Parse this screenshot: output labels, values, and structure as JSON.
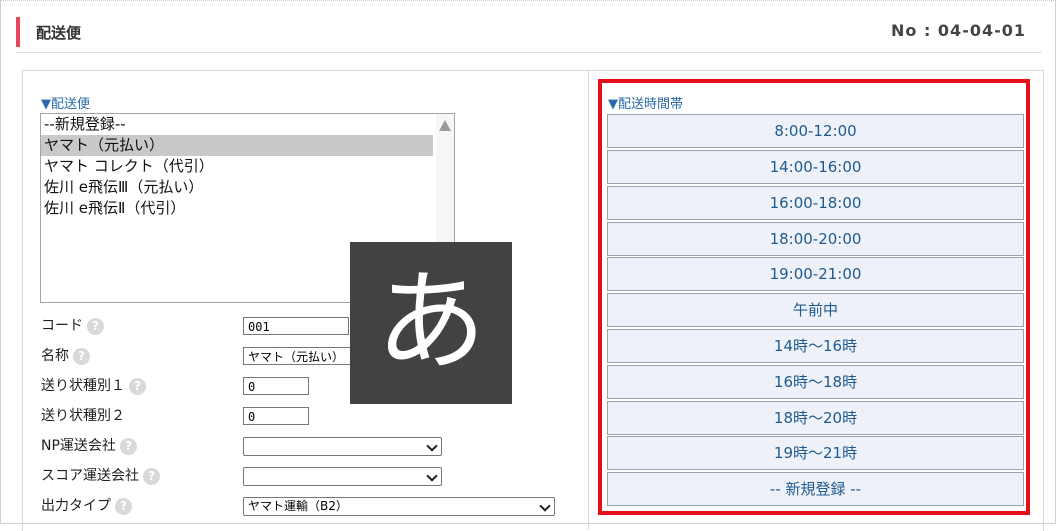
{
  "header": {
    "title": "配送便",
    "doc_no": "No : 04-04-01"
  },
  "left": {
    "section_label": "▼配送便",
    "list_options": [
      "--新規登録--",
      "ヤマト（元払い）",
      "ヤマト コレクト（代引）",
      "佐川 e飛伝Ⅲ（元払い）",
      "佐川 e飛伝Ⅱ（代引）"
    ],
    "selected_index": 1,
    "form": {
      "code_label": "コード",
      "code_value": "001",
      "name_label": "名称",
      "name_value": "ヤマト（元払い）",
      "slip1_label": "送り状種別１",
      "slip1_value": "0",
      "slip2_label": "送り状種別２",
      "slip2_value": "0",
      "np_label": "NP運送会社",
      "np_value": "",
      "score_label": "スコア運送会社",
      "score_value": "",
      "output_label": "出力タイプ",
      "output_value": "ヤマト運輸（B2）",
      "help_glyph": "?"
    }
  },
  "ime_indicator": "あ",
  "right": {
    "section_label": "▼配送時間帯",
    "slots": [
      "8:00-12:00",
      "14:00-16:00",
      "16:00-18:00",
      "18:00-20:00",
      "19:00-21:00",
      "午前中",
      "14時～16時",
      "16時～18時",
      "18時～20時",
      "19時～21時",
      "-- 新規登録 --"
    ]
  },
  "colors": {
    "accent": "#e8495a",
    "highlight_border": "#e3101a",
    "slot_text": "#1f5a8e",
    "slot_bg": "#eef2f8",
    "section_label": "#2a6aa8"
  }
}
